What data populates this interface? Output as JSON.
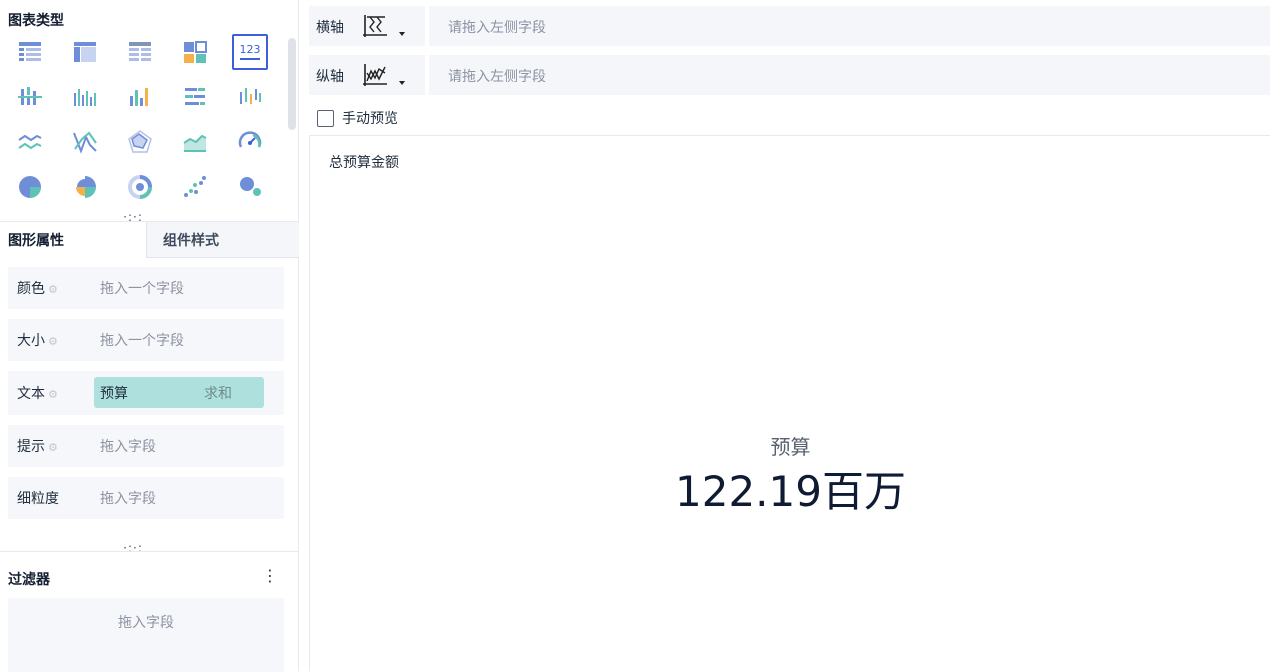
{
  "left_panel": {
    "chart_types": {
      "title": "图表类型",
      "icons": [
        "table-icon",
        "crosstab-icon",
        "grid-table-icon",
        "block-table-icon",
        "kpi-number-icon",
        "grouped-bar-icon",
        "multi-bar-icon",
        "bar-chart-icon",
        "horizontal-bar-icon",
        "column-chart-icon",
        "line-chart-icon",
        "crossing-line-icon",
        "radar-chart-icon",
        "area-chart-icon",
        "gauge-icon",
        "pie-chart-icon",
        "rose-pie-icon",
        "donut-chart-icon",
        "scatter-plot-icon",
        "bubble-chart-icon"
      ],
      "active_index": 4,
      "active_icon_text": "123"
    },
    "tabs": {
      "graphic_props": "图形属性",
      "component_style": "组件样式"
    },
    "props": [
      {
        "label": "颜色",
        "placeholder": "拖入一个字段"
      },
      {
        "label": "大小",
        "placeholder": "拖入一个字段"
      },
      {
        "label": "文本",
        "field": "预算",
        "aggregation": "求和"
      },
      {
        "label": "提示",
        "placeholder": "拖入字段"
      },
      {
        "label": "细粒度",
        "placeholder": "拖入字段"
      }
    ],
    "filter": {
      "title": "过滤器",
      "placeholder": "拖入字段"
    }
  },
  "axes": {
    "x": {
      "label": "横轴",
      "placeholder": "请拖入左侧字段"
    },
    "y": {
      "label": "纵轴",
      "placeholder": "请拖入左侧字段"
    }
  },
  "manual_preview": "手动预览",
  "canvas": {
    "title": "总预算金额",
    "kpi_name": "预算",
    "kpi_value": "122.19百万"
  },
  "colors": {
    "accent": "#3d5fd9",
    "pill": "#aee1dd",
    "field_bg": "#f6f7fa"
  }
}
